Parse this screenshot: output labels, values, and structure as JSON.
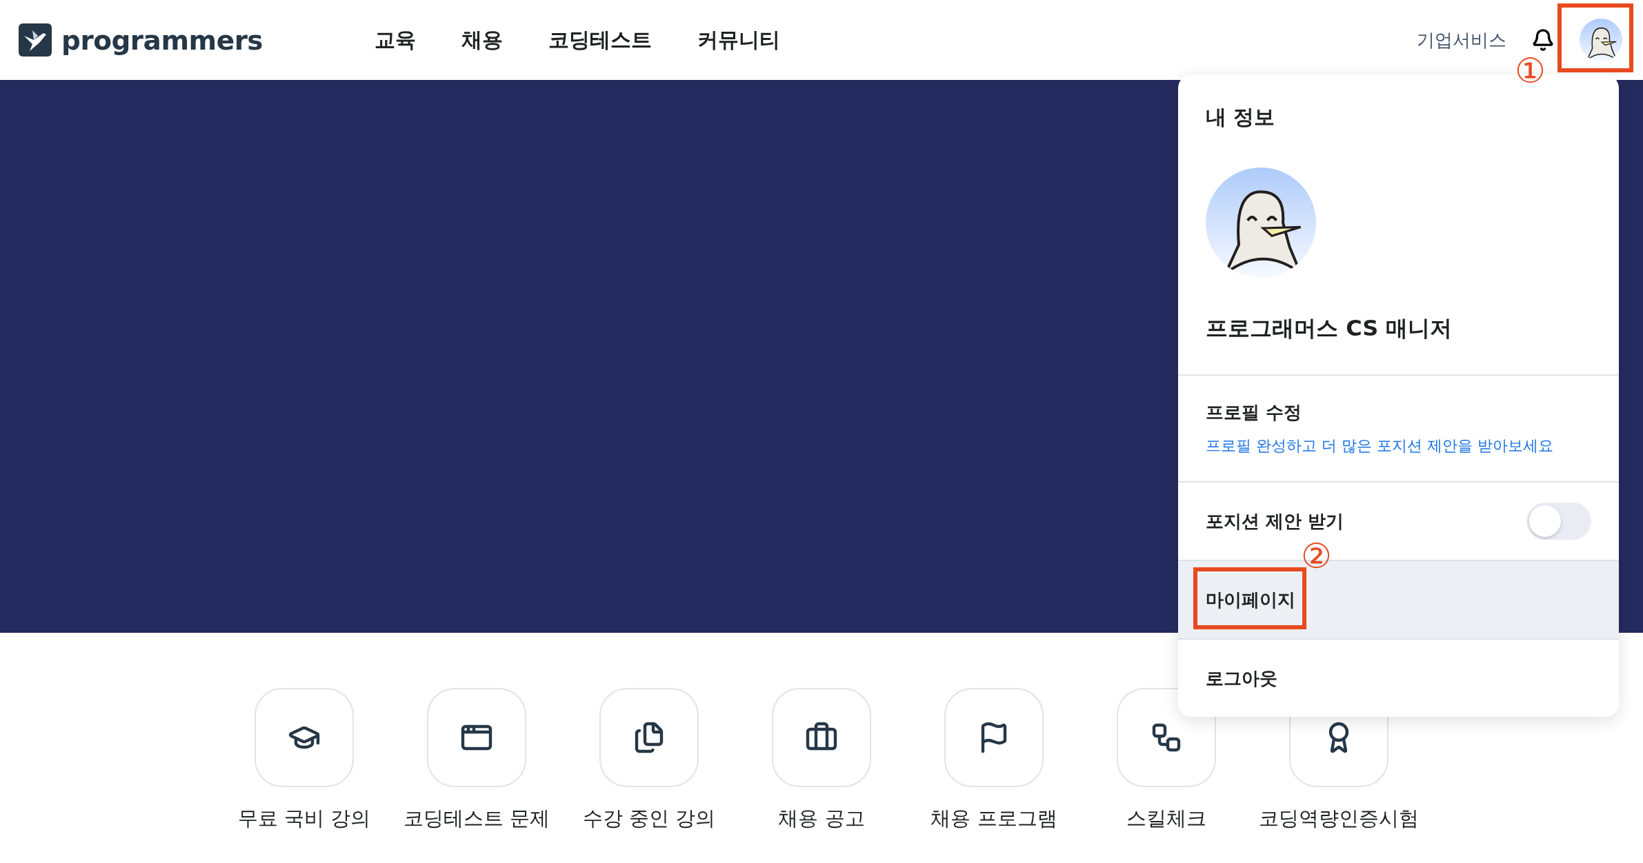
{
  "header": {
    "logo": "programmers",
    "nav": [
      {
        "label": "교육"
      },
      {
        "label": "채용"
      },
      {
        "label": "코딩테스트"
      },
      {
        "label": "커뮤니티"
      }
    ],
    "business_link": "기업서비스"
  },
  "profile_menu": {
    "title": "내 정보",
    "user_name": "프로그래머스 CS 매니저",
    "items": [
      {
        "kind": "link_item",
        "label": "프로필 수정",
        "subtitle": "프로필 완성하고 더 많은 포지션 제안을 받아보세요",
        "selected": false
      },
      {
        "kind": "toggle",
        "label": "포지션 제안 받기",
        "on": false,
        "selected": false
      },
      {
        "kind": "plain",
        "label": "마이페이지",
        "selected": true
      },
      {
        "kind": "plain",
        "label": "로그아웃",
        "selected": false
      }
    ]
  },
  "shortcuts": [
    {
      "label": "무료 국비 강의"
    },
    {
      "label": "코딩테스트 문제"
    },
    {
      "label": "수강 중인 강의"
    },
    {
      "label": "채용 공고"
    },
    {
      "label": "채용 프로그램"
    },
    {
      "label": "스킬체크"
    },
    {
      "label": "코딩역량인증시험"
    }
  ],
  "annotations": [
    {
      "label": "①"
    },
    {
      "label": "②"
    }
  ]
}
